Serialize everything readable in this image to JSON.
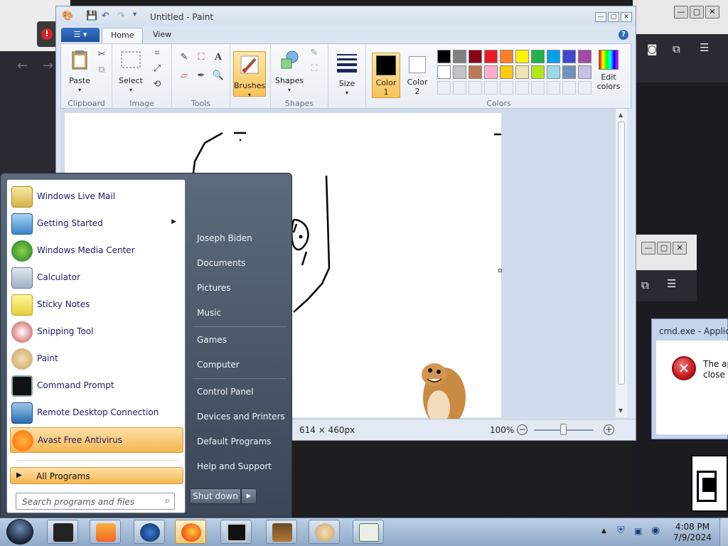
{
  "paint": {
    "title": "Untitled - Paint",
    "file_button": "☰ ▾",
    "tabs": [
      "Home",
      "View"
    ],
    "ribbon": {
      "paste": "Paste",
      "select": "Select",
      "brushes": "Brushes",
      "shapes": "Shapes",
      "size": "Size",
      "color1": "Color 1",
      "color2": "Color 2",
      "edit_colors": "Edit colors",
      "groups": [
        "Clipboard",
        "Image",
        "Tools",
        "Shapes",
        "Colors"
      ]
    },
    "palette_row1": [
      "#000000",
      "#7f7f7f",
      "#880015",
      "#ed1c24",
      "#ff7f27",
      "#fff200",
      "#22b14c",
      "#00a2e8",
      "#3f48cc",
      "#a349a4"
    ],
    "palette_row2": [
      "#ffffff",
      "#c3c3c3",
      "#b97a57",
      "#ffaec9",
      "#ffc90e",
      "#efe4b0",
      "#b5e61d",
      "#99d9ea",
      "#7092be",
      "#c8bfe7"
    ],
    "color1_value": "#000000",
    "color2_value": "#ffffff",
    "status": {
      "dimensions": "614 × 460px",
      "zoom": "100%"
    }
  },
  "error_dialog": {
    "title": "cmd.exe - Applicat",
    "text_line1": "The ap",
    "text_line2": "close t"
  },
  "start_menu": {
    "programs": [
      {
        "label": "Windows Live Mail",
        "icon": "mail-icon",
        "submenu": false
      },
      {
        "label": "Getting Started",
        "icon": "getting-started-icon",
        "submenu": true
      },
      {
        "label": "Windows Media Center",
        "icon": "media-center-icon",
        "submenu": false
      },
      {
        "label": "Calculator",
        "icon": "calculator-icon",
        "submenu": false
      },
      {
        "label": "Sticky Notes",
        "icon": "sticky-notes-icon",
        "submenu": false
      },
      {
        "label": "Snipping Tool",
        "icon": "snipping-tool-icon",
        "submenu": false
      },
      {
        "label": "Paint",
        "icon": "paint-icon",
        "submenu": false
      },
      {
        "label": "Command Prompt",
        "icon": "command-prompt-icon",
        "submenu": false
      },
      {
        "label": "Remote Desktop Connection",
        "icon": "remote-desktop-icon",
        "submenu": false
      },
      {
        "label": "Avast Free Antivirus",
        "icon": "avast-icon",
        "submenu": false
      }
    ],
    "all_programs": "All Programs",
    "search_placeholder": "Search programs and files",
    "right_items": [
      "Joseph Biden",
      "Documents",
      "Pictures",
      "Music",
      "Games",
      "Computer",
      "Control Panel",
      "Devices and Printers",
      "Default Programs",
      "Help and Support"
    ],
    "shutdown": "Shut down"
  },
  "taskbar": {
    "time": "4:08 PM",
    "date": "7/9/2024",
    "apps": [
      "start-orb",
      "folder-icon",
      "media-player-icon",
      "browser-globe-icon",
      "firefox-icon",
      "command-prompt-icon",
      "bonzibuddy-icon",
      "paint-icon",
      "notepad-icon"
    ]
  }
}
